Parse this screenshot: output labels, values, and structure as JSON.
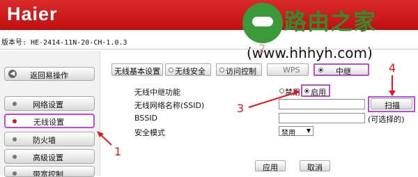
{
  "header": {
    "logo": "Haier"
  },
  "watermark": {
    "site_name": "路由之家",
    "url": "(www.hhhyh.com)"
  },
  "version": {
    "text": "版本号: HE-2414-11N-20-CH-1.0.3"
  },
  "sidebar": {
    "back_label": "返回易操作",
    "items": [
      {
        "label": "网络设置"
      },
      {
        "label": "无线设置",
        "active": true
      },
      {
        "label": "防火墙"
      },
      {
        "label": "高级设置"
      },
      {
        "label": "带宽控制"
      }
    ]
  },
  "tabs": [
    {
      "label": "无线基本设置"
    },
    {
      "label": "无线安全"
    },
    {
      "label": "访问控制"
    },
    {
      "label": "WPS"
    },
    {
      "label": "中继",
      "active": true
    }
  ],
  "form": {
    "repeater_function": {
      "label": "无线中继功能",
      "options": [
        "禁用",
        "启用"
      ],
      "selected": "启用"
    },
    "ssid": {
      "label": "无线网络名称(SSID)",
      "value": "",
      "scan_button": "扫描"
    },
    "bssid": {
      "label": "BSSID",
      "value": "",
      "hint": "(可选择的)"
    },
    "security_mode": {
      "label": "安全模式",
      "value": "禁用"
    },
    "apply_button": "应用",
    "cancel_button": "取消"
  },
  "annotations": [
    "1",
    "2",
    "3",
    "4"
  ],
  "colors": {
    "header_red": "#c91a1c",
    "highlight_purple": "#c04bd4",
    "annotation_red": "#e8141b",
    "watermark_green": "#2c8f2c"
  }
}
